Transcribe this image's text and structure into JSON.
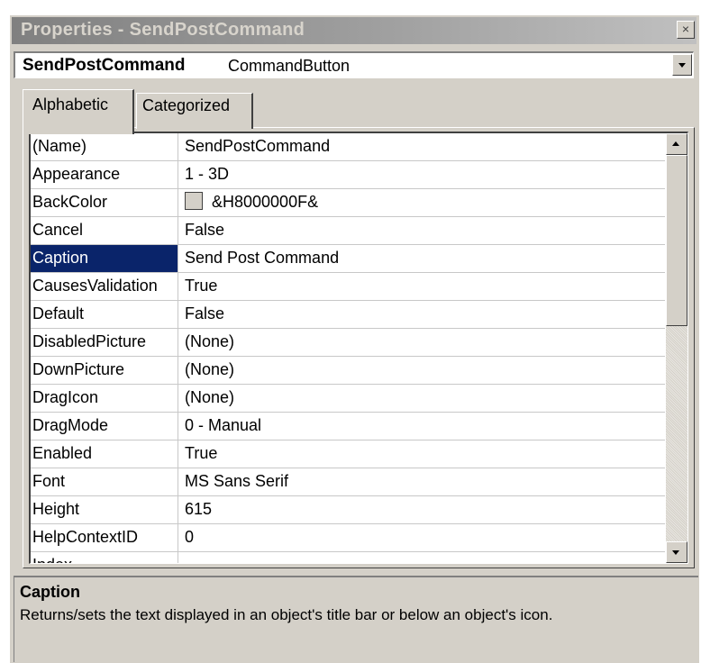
{
  "window": {
    "title": "Properties - SendPostCommand",
    "close_glyph": "×"
  },
  "object_selector": {
    "name": "SendPostCommand",
    "type": "CommandButton"
  },
  "tabs": [
    {
      "label": "Alphabetic",
      "active": true
    },
    {
      "label": "Categorized",
      "active": false
    }
  ],
  "properties": [
    {
      "name": "(Name)",
      "value": "SendPostCommand"
    },
    {
      "name": "Appearance",
      "value": "1 - 3D"
    },
    {
      "name": "BackColor",
      "value": "&H8000000F&",
      "swatch_color": "#d4d0c8"
    },
    {
      "name": "Cancel",
      "value": "False"
    },
    {
      "name": "Caption",
      "value": "Send Post Command",
      "selected": true
    },
    {
      "name": "CausesValidation",
      "value": "True"
    },
    {
      "name": "Default",
      "value": "False"
    },
    {
      "name": "DisabledPicture",
      "value": "(None)"
    },
    {
      "name": "DownPicture",
      "value": "(None)"
    },
    {
      "name": "DragIcon",
      "value": "(None)"
    },
    {
      "name": "DragMode",
      "value": "0 - Manual"
    },
    {
      "name": "Enabled",
      "value": "True"
    },
    {
      "name": "Font",
      "value": "MS Sans Serif"
    },
    {
      "name": "Height",
      "value": "615"
    },
    {
      "name": "HelpContextID",
      "value": "0"
    },
    {
      "name": "Index",
      "value": ""
    }
  ],
  "description": {
    "title": "Caption",
    "text": "Returns/sets the text displayed in an object's title bar or below an object's icon."
  },
  "colors": {
    "selection": "#0a246a",
    "face": "#d4d0c8"
  }
}
